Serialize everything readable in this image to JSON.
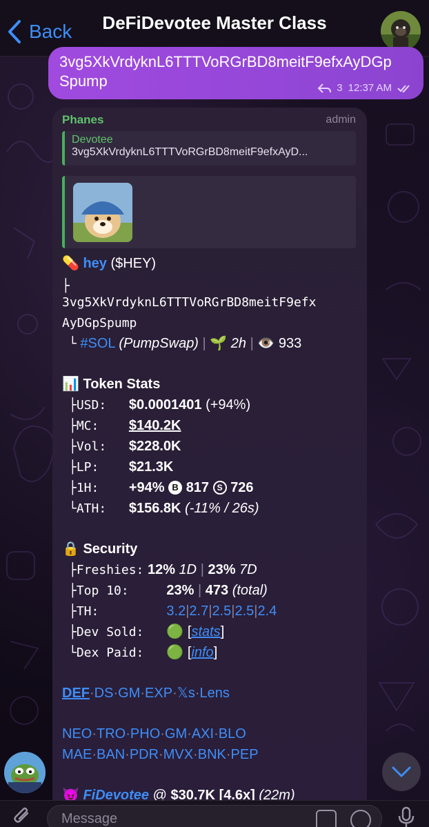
{
  "header": {
    "back_label": "Back",
    "title": "DeFiDevotee Master Class"
  },
  "outgoing": {
    "text_line1": "3vg5XkVrdyknL6TTTVoRGrBD8meitF9efxAyDGp",
    "text_line2": "Spump",
    "reply_count": "3",
    "time": "12:37 AM"
  },
  "message": {
    "sender": "Phanes",
    "role": "admin",
    "reply": {
      "name": "Devotee",
      "text": "3vg5XkVrdyknL6TTTVoRGrBD8meitF9efxAyD..."
    },
    "token": {
      "emoji": "💊",
      "name": "hey",
      "ticker": "($HEY)",
      "branch": "├",
      "address_line1": "3vg5XkVrdyknL6TTTVoRGrBD8meitF9efx",
      "address_line2": "AyDGpSpump",
      "corner": "└",
      "chain": "#SOL",
      "dex": "(PumpSwap)",
      "age_emoji": "🌱",
      "age": "2h",
      "views_emoji": "👁️",
      "views": "933"
    },
    "stats": {
      "emoji": "📊",
      "heading": "Token Stats",
      "rows": [
        {
          "tree": "├",
          "key": "USD:",
          "value": "$0.0001401",
          "extra": "(+94%)"
        },
        {
          "tree": "├",
          "key": "MC:",
          "value": "$140.2K",
          "extra": ""
        },
        {
          "tree": "├",
          "key": "Vol:",
          "value": "$228.0K",
          "extra": ""
        },
        {
          "tree": "├",
          "key": "LP:",
          "value": "$21.3K",
          "extra": ""
        },
        {
          "tree": "├",
          "key": "1H:",
          "value": "+94%",
          "extra": ""
        },
        {
          "tree": "└",
          "key": "ATH:",
          "value": "$156.8K",
          "extra": "(-11% / 26s)"
        }
      ],
      "buys_icon": "B",
      "buys": "817",
      "sells_icon": "S",
      "sells": "726"
    },
    "security": {
      "emoji": "🔒",
      "heading": "Security",
      "freshies": {
        "tree": "├",
        "key": "Freshies:",
        "v1": "12%",
        "p1": "1D",
        "sep": "|",
        "v2": "23%",
        "p2": "7D"
      },
      "top10": {
        "tree": "├",
        "key": "Top 10:",
        "v1": "23%",
        "sep": "|",
        "v2": "473",
        "p2": "(total)"
      },
      "th": {
        "tree": "├",
        "key": "TH:",
        "values": [
          "3.2",
          "2.7",
          "2.5",
          "2.5",
          "2.4"
        ],
        "sep": "|"
      },
      "dev_sold": {
        "tree": "├",
        "key": "Dev Sold:",
        "status_emoji": "🟢",
        "link": "stats"
      },
      "dex_paid": {
        "tree": "└",
        "key": "Dex Paid:",
        "status_emoji": "🟢",
        "link": "info"
      }
    },
    "links_row1": [
      "DEF",
      "DS",
      "GM",
      "EXP",
      "𝕏s",
      "Lens"
    ],
    "links_row2": [
      "NEO",
      "TRO",
      "PHO",
      "GM",
      "AXI",
      "BLO"
    ],
    "links_row3": [
      "MAE",
      "BAN",
      "PDR",
      "MVX",
      "BNK",
      "PEP"
    ],
    "link_dot": "·",
    "footer": {
      "emoji": "😈",
      "name": "FiDevotee",
      "at": "@",
      "mc": "$30.7K",
      "mult": "[4.6x]",
      "age": "(22m)"
    }
  },
  "composer": {
    "placeholder": "Message"
  },
  "colors": {
    "accent": "#3e8ef7",
    "outgoing_bubble": "#a04adf",
    "incoming_bubble": "#2b2036",
    "sender": "#5fc26a"
  }
}
